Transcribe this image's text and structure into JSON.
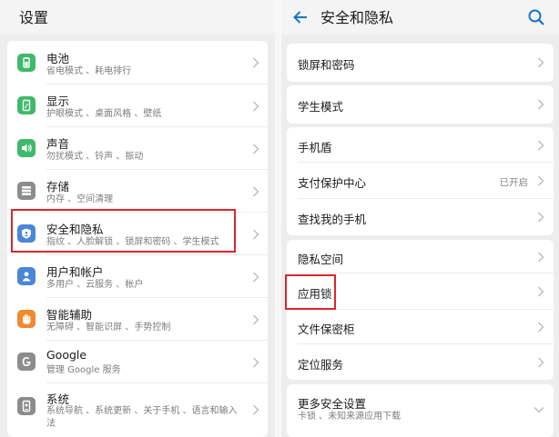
{
  "left": {
    "title": "设置",
    "items": [
      {
        "title": "电池",
        "subtitle": "省电模式 、耗电排行",
        "icon": "battery-icon",
        "color": "#3fb96b"
      },
      {
        "title": "显示",
        "subtitle": "护眼模式 、桌面风格 、壁纸",
        "icon": "display-icon",
        "color": "#3fb96b"
      },
      {
        "title": "声音",
        "subtitle": "勿扰模式 、铃声 、振动",
        "icon": "sound-icon",
        "color": "#3fb96b"
      },
      {
        "title": "存储",
        "subtitle": "内存 、空间清理",
        "icon": "storage-icon",
        "color": "#8c8c8c"
      },
      {
        "title": "安全和隐私",
        "subtitle": "指纹 、人脸解锁 、锁屏和密码 、学生模式",
        "icon": "shield-icon",
        "color": "#4a86d8"
      },
      {
        "title": "用户和帐户",
        "subtitle": "多用户 、云服务 、帐户",
        "icon": "user-icon",
        "color": "#4a86d8"
      },
      {
        "title": "智能辅助",
        "subtitle": "无障碍 、智能识屏 、手势控制",
        "icon": "hand-icon",
        "color": "#f08a2d"
      },
      {
        "title": "Google",
        "subtitle": "管理 Google 服务",
        "icon": "google-icon",
        "color": "#8c8c8c"
      },
      {
        "title": "系统",
        "subtitle": "系统导航 、系统更新 、关于手机 、语言和输入法",
        "icon": "system-icon",
        "color": "#8c8c8c"
      }
    ]
  },
  "right": {
    "title": "安全和隐私",
    "groups": [
      [
        {
          "title": "锁屏和密码"
        }
      ],
      [
        {
          "title": "学生模式"
        }
      ],
      [
        {
          "title": "手机盾"
        },
        {
          "title": "支付保护中心",
          "status": "已开启"
        },
        {
          "title": "查找我的手机"
        }
      ],
      [
        {
          "title": "隐私空间"
        },
        {
          "title": "应用锁"
        },
        {
          "title": "文件保密柜"
        },
        {
          "title": "定位服务"
        }
      ],
      [
        {
          "title": "更多安全设置",
          "subtitle": "卡锁 、未知来源应用下载"
        }
      ]
    ]
  },
  "colors": {
    "accent": "#1a73c8",
    "highlight": "#d9272e",
    "background": "#ededed"
  }
}
